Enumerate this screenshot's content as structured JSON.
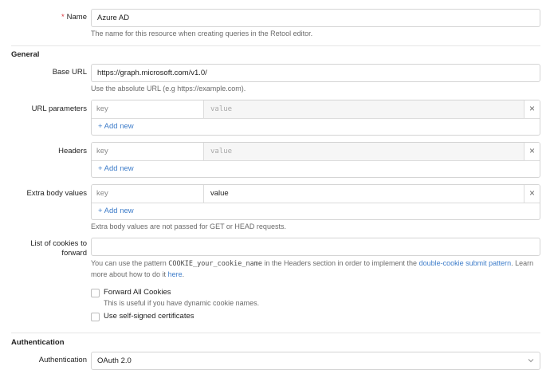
{
  "name": {
    "label": "Name",
    "required_mark": "*",
    "value": "Azure AD",
    "help": "The name for this resource when creating queries in the Retool editor."
  },
  "general": {
    "section_title": "General",
    "base_url": {
      "label": "Base URL",
      "value": "https://graph.microsoft.com/v1.0/",
      "help": "Use the absolute URL (e.g https://example.com)."
    },
    "url_parameters": {
      "label": "URL parameters",
      "key_placeholder": "key",
      "value_placeholder": "value",
      "add_label": "+ Add new"
    },
    "headers": {
      "label": "Headers",
      "key_placeholder": "key",
      "value_placeholder": "value",
      "add_label": "+ Add new"
    },
    "extra_body": {
      "label": "Extra body values",
      "key_placeholder": "key",
      "value_text": "value",
      "add_label": "+ Add new",
      "help": "Extra body values are not passed for GET or HEAD requests."
    },
    "cookies": {
      "label_line1": "List of cookies to",
      "label_line2": "forward",
      "value": "",
      "help_part1": "You can use the pattern ",
      "help_code": "COOKIE_your_cookie_name",
      "help_part2": " in the Headers section in order to implement the ",
      "help_link1": "double-cookie submit pattern",
      "help_part3": ". Learn",
      "help_part4": "more about how to do it ",
      "help_link2": "here",
      "help_part5": "."
    },
    "forward_all_cookies": {
      "label": "Forward All Cookies",
      "checked": false,
      "help": "This is useful if you have dynamic cookie names."
    },
    "self_signed": {
      "label": "Use self-signed certificates",
      "checked": false
    }
  },
  "authentication": {
    "section_title": "Authentication",
    "label": "Authentication",
    "value": "OAuth 2.0"
  },
  "icons": {
    "delete": "close-icon",
    "dropdown": "chevron-down-icon"
  }
}
